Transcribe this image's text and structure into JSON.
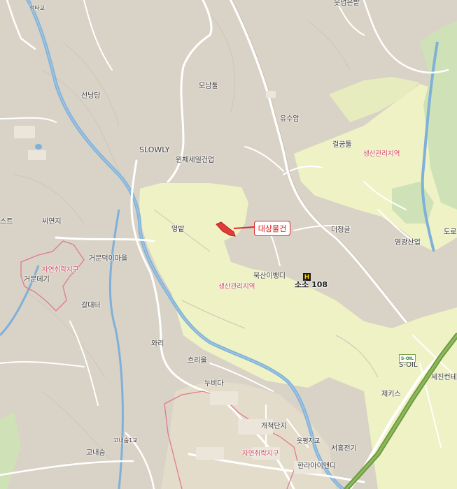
{
  "callout": {
    "label": "대상물건"
  },
  "labels": {
    "jeongtagyo": "정타교",
    "utneunbat": "웃넘은밭",
    "seonangdang": "선낭당",
    "monamteul": "모남툴",
    "yusuam": "유수암",
    "slowly": "SLOWLY",
    "wonjesaeil": "윈체세일건업",
    "geolgeumteul": "걸굼툴",
    "saengsan_upper": "생산관리지역",
    "ssiyeonji": "씨연지",
    "seuteu": "스트",
    "jayeon_left": "자연취락지구",
    "geomundeukimaeul": "거문덕이마을",
    "geomundeugi": "거문데기",
    "eongbat": "엉밭",
    "deojeonggeul": "더정글",
    "doro": "도로",
    "yeonggwangsaneop": "영광산업",
    "buksanibaengdi": "북산이뱅디",
    "soso108": "소소 108",
    "saengsan_mid": "생산관리지역",
    "galdaeteo": "갈대터",
    "wari": "와리",
    "heurieul": "흐리울",
    "soil": "S-OIL",
    "sejinkeonte": "세진컨테이",
    "nubida": "누비다",
    "jekiseu": "제키스",
    "gaecheokdanji": "개척단지",
    "gonaesum1": "고내숨1교",
    "gonaesum": "고내숨",
    "utpyeongjigyo": "웃평지교",
    "seoheungjeongi": "서흥전기",
    "jayeon_bottom": "자연취락지구",
    "hallaiaendi": "한라아이앤디"
  },
  "icons": {
    "hotel": "H",
    "soil_badge": "S-OIL"
  },
  "colors": {
    "base": "#d9d2c6",
    "production_zone": "#eef2c4",
    "green_area": "#cfe2b7",
    "river": "#7fb1d8",
    "road": "#ffffff",
    "highway": "#6e9a3d",
    "zone_border": "#e07a8f",
    "callout_red": "#e0282a",
    "parcel": "#e03c3c"
  }
}
